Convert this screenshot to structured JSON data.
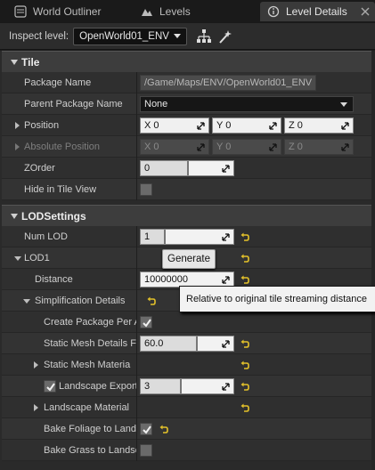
{
  "tabs": [
    {
      "label": "World Outliner",
      "icon": "world-outliner-icon"
    },
    {
      "label": "Levels",
      "icon": "levels-icon"
    },
    {
      "label": "Level Details",
      "icon": "level-details-icon"
    }
  ],
  "toolbar": {
    "inspect_label": "Inspect level:",
    "inspect_value": "OpenWorld01_ENV"
  },
  "tile": {
    "heading": "Tile",
    "package_name_label": "Package Name",
    "package_name_value": "/Game/Maps/ENV/OpenWorld01_ENV",
    "parent_package_label": "Parent Package Name",
    "parent_package_value": "None",
    "position_label": "Position",
    "position": {
      "x": "X  0",
      "y": "Y  0",
      "z": "Z  0"
    },
    "absolute_position_label": "Absolute Position",
    "absolute_position": {
      "x": "X  0",
      "y": "Y  0",
      "z": "Z  0"
    },
    "zorder_label": "ZOrder",
    "zorder_value": "0",
    "hide_in_tile_view_label": "Hide in Tile View",
    "hide_in_tile_view_checked": false
  },
  "lod_settings": {
    "heading": "LODSettings",
    "num_lod_label": "Num LOD",
    "num_lod_value": "1",
    "lod1_label": "LOD1",
    "generate_button": "Generate",
    "distance_label": "Distance",
    "distance_value": "10000000",
    "tooltip": "Relative to original tile streaming distance",
    "simplification_label": "Simplification Details",
    "create_package_label": "Create Package Per A",
    "create_package_checked": true,
    "static_mesh_details_label": "Static Mesh Details F",
    "static_mesh_details_value": "60.0",
    "static_mesh_material_label": "Static Mesh Materia",
    "landscape_export_label": "Landscape Export",
    "landscape_export_checked": true,
    "landscape_export_value": "3",
    "landscape_material_label": "Landscape Material",
    "bake_foliage_label": "Bake Foliage to Land",
    "bake_foliage_checked": true,
    "bake_grass_label": "Bake Grass to Landsc",
    "bake_grass_checked": false
  },
  "colors": {
    "reset_arrow": "#e3c12a",
    "panel_bg": "#2a2a2a",
    "category_bg": "#3d3d3d"
  }
}
